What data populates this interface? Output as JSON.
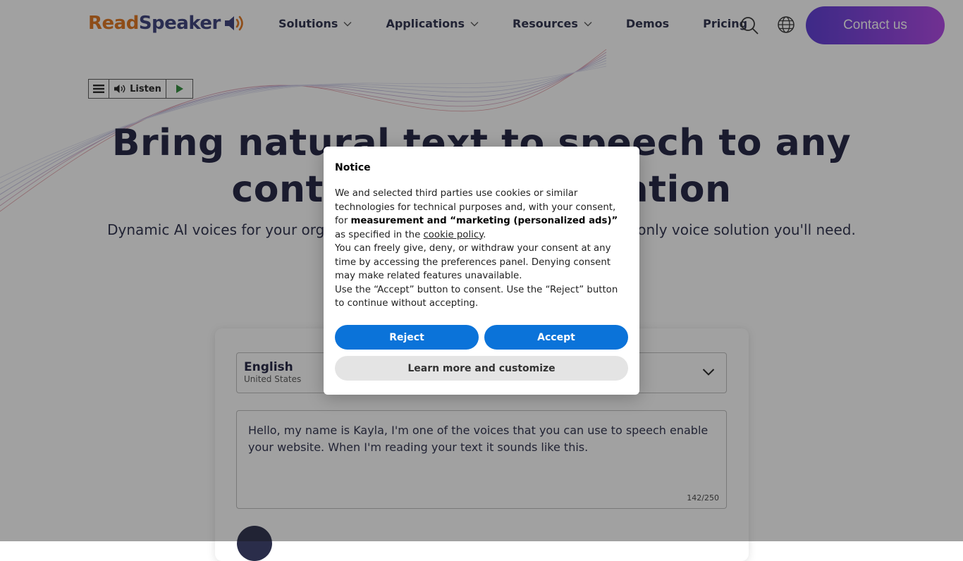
{
  "header": {
    "logo_read": "Read",
    "logo_speaker": "Speaker",
    "nav": [
      {
        "label": "Solutions",
        "has_dropdown": true
      },
      {
        "label": "Applications",
        "has_dropdown": true
      },
      {
        "label": "Resources",
        "has_dropdown": true
      },
      {
        "label": "Demos",
        "has_dropdown": false
      },
      {
        "label": "Pricing",
        "has_dropdown": false
      }
    ],
    "search_icon": "search-icon",
    "globe_icon": "globe-icon",
    "contact_label": "Contact us"
  },
  "listen_widget": {
    "menu_icon": "menu-icon",
    "listen_label": "Listen",
    "play_icon": "play-icon"
  },
  "hero": {
    "title_line1": "Bring natural text to speech to any",
    "title_line2": "content and application",
    "subtitle": "Dynamic AI voices for your organization, in any language, any format. The only voice solution you'll need."
  },
  "demo": {
    "language": "English",
    "region": "United States",
    "text": "Hello, my name is Kayla, I'm one of the voices that you can use to speech enable your website. When I'm reading your text it sounds like this.",
    "char_count": "142/250"
  },
  "cookie_notice": {
    "title": "Notice",
    "p1_start": "We and selected third parties use cookies or similar technologies for technical purposes and, with your consent, for ",
    "p1_bold": "measurement and “marketing (personalized ads)”",
    "p1_mid": " as specified in the ",
    "p1_link": "cookie policy",
    "p1_end": ".",
    "p2": "You can freely give, deny, or withdraw your consent at any time by accessing the preferences panel. Denying consent may make related features unavailable.",
    "p3": "Use the “Accept” button to consent. Use the “Reject” button to continue without accepting.",
    "reject_label": "Reject",
    "accept_label": "Accept",
    "learn_label": "Learn more and customize"
  },
  "colors": {
    "brand_orange": "#e0731c",
    "brand_navy": "#3a3f7a",
    "contact_gradient_start": "#5a39d4",
    "contact_gradient_end": "#b044e6",
    "button_blue": "#0b73d9"
  }
}
